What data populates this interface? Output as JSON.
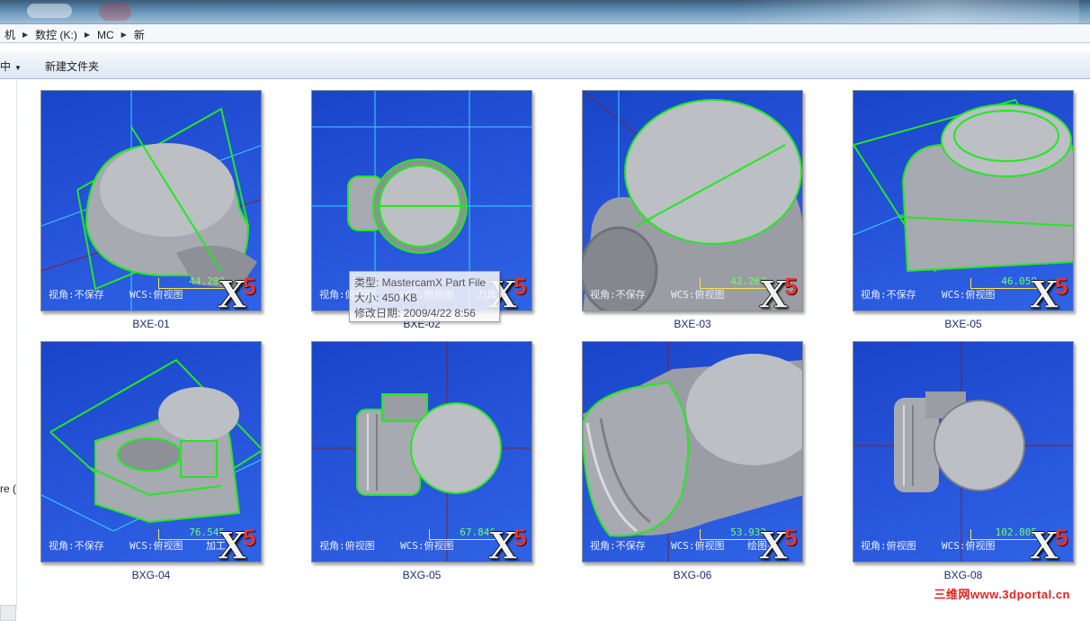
{
  "breadcrumb": [
    "机",
    "数控 (K:)",
    "MC",
    "新"
  ],
  "toolbar": {
    "include_label": "中",
    "new_folder_label": "新建文件夹"
  },
  "nav": {
    "cut_text": "re ("
  },
  "hud": {
    "view_unsaved": "视角:不保存",
    "view_top": "视角:俯视图",
    "wcs_top": "WCS:俯视图",
    "tool_plane": "刀具",
    "tool_plane_cut": "加工刀",
    "draw_plane": "绘图平"
  },
  "files": [
    {
      "name": "BXE-01",
      "scale": "44.288",
      "view": "视角:不保存"
    },
    {
      "name": "BXE-02",
      "scale": "",
      "view": "视角:俯视图"
    },
    {
      "name": "BXE-03",
      "scale": "42.263",
      "view": "视角:不保存"
    },
    {
      "name": "BXE-05",
      "scale": "46.058",
      "view": "视角:不保存"
    },
    {
      "name": "BXG-04",
      "scale": "76.545",
      "view": "视角:不保存"
    },
    {
      "name": "BXG-05",
      "scale": "67.846",
      "view": "视角:俯视图"
    },
    {
      "name": "BXG-06",
      "scale": "53.932",
      "view": "视角:不保存"
    },
    {
      "name": "BXG-08",
      "scale": "102.805",
      "view": "视角:俯视图"
    }
  ],
  "tooltip": {
    "type": "类型: MastercamX Part File",
    "size": "大小: 450 KB",
    "modified": "修改日期: 2009/4/22 8:56"
  },
  "logo": {
    "x": "X",
    "five": "5"
  },
  "watermark": "三维网www.3dportal.cn",
  "colors": {
    "viewport_blue": "#2552d8",
    "wireframe_green": "#22e822",
    "axis_cyan": "#38d6ff",
    "scale_yellow": "#ffe34a",
    "logo_red": "#d63a3a"
  }
}
